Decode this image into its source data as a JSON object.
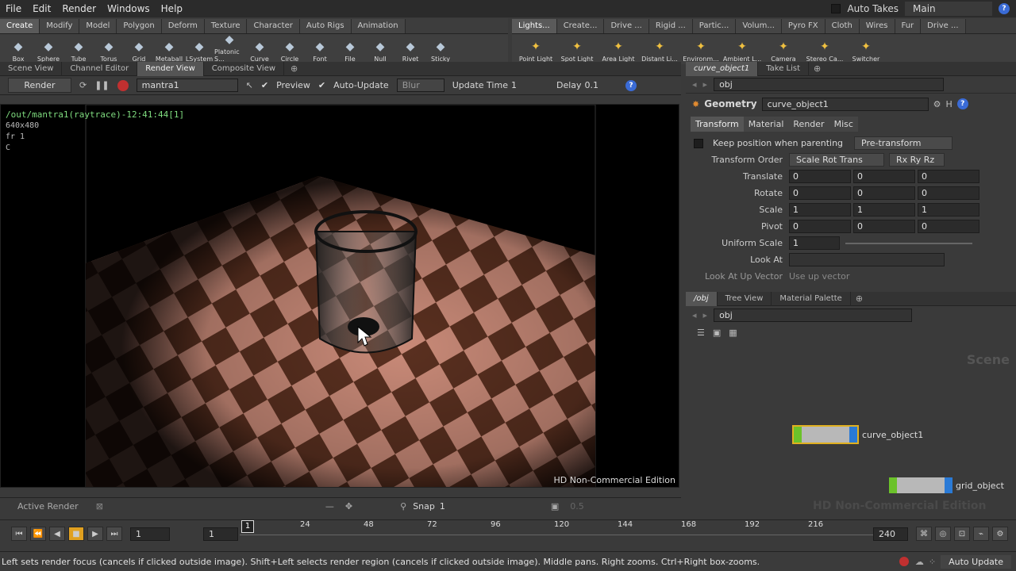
{
  "menubar": {
    "items": [
      "File",
      "Edit",
      "Render",
      "Windows",
      "Help"
    ],
    "auto_takes": "Auto Takes",
    "desktop": "Main"
  },
  "shelf_left": {
    "tabs": [
      "Create",
      "Modify",
      "Model",
      "Polygon",
      "Deform",
      "Texture",
      "Character",
      "Auto Rigs",
      "Animation"
    ],
    "tools": [
      {
        "label": "Box",
        "icon": "box-icon"
      },
      {
        "label": "Sphere",
        "icon": "sphere-icon"
      },
      {
        "label": "Tube",
        "icon": "tube-icon"
      },
      {
        "label": "Torus",
        "icon": "torus-icon"
      },
      {
        "label": "Grid",
        "icon": "grid-icon"
      },
      {
        "label": "Metaball",
        "icon": "metaball-icon"
      },
      {
        "label": "LSystem",
        "icon": "lsystem-icon"
      },
      {
        "label": "Platonic S...",
        "icon": "platonic-icon"
      },
      {
        "label": "Curve",
        "icon": "curve-icon"
      },
      {
        "label": "Circle",
        "icon": "circle-icon"
      },
      {
        "label": "Font",
        "icon": "font-icon"
      },
      {
        "label": "File",
        "icon": "file-icon"
      },
      {
        "label": "Null",
        "icon": "null-icon"
      },
      {
        "label": "Rivet",
        "icon": "rivet-icon"
      },
      {
        "label": "Sticky",
        "icon": "sticky-icon"
      }
    ]
  },
  "shelf_right": {
    "tabs": [
      "Lights...",
      "Create...",
      "Drive ...",
      "Rigid ...",
      "Partic...",
      "Volum...",
      "Pyro FX",
      "Cloth",
      "Wires",
      "Fur",
      "Drive ..."
    ],
    "tools": [
      {
        "label": "Point Light",
        "icon": "point-light-icon"
      },
      {
        "label": "Spot Light",
        "icon": "spot-light-icon"
      },
      {
        "label": "Area Light",
        "icon": "area-light-icon"
      },
      {
        "label": "Distant Li...",
        "icon": "distant-light-icon"
      },
      {
        "label": "Environm...",
        "icon": "environment-light-icon"
      },
      {
        "label": "Ambient L...",
        "icon": "ambient-light-icon"
      },
      {
        "label": "Camera",
        "icon": "camera-icon"
      },
      {
        "label": "Stereo Ca...",
        "icon": "stereo-camera-icon"
      },
      {
        "label": "Switcher",
        "icon": "switcher-icon"
      }
    ]
  },
  "left_pane": {
    "tabs": [
      "Scene View",
      "Channel Editor",
      "Render View",
      "Composite View"
    ],
    "render_button": "Render",
    "renderer": "mantra1",
    "preview": "Preview",
    "auto_update": "Auto-Update",
    "blur": "Blur",
    "update_time_label": "Update Time",
    "update_time_value": "1",
    "delay_label": "Delay",
    "delay_value": "0.1",
    "overlay_path": "/out/mantra1(raytrace)-12:41:44[1]",
    "overlay_res": "640x480",
    "overlay_frame": "fr 1",
    "overlay_c": "C",
    "watermark": "HD Non-Commercial Edition",
    "bottom_label": "Active Render",
    "snap_label": "Snap",
    "snap_value": "1",
    "dim_value": "0.5"
  },
  "param_pane": {
    "tabs": [
      "curve_object1",
      "Take List"
    ],
    "path": "obj",
    "type_label": "Geometry",
    "node_name": "curve_object1",
    "sub_tabs": [
      "Transform",
      "Material",
      "Render",
      "Misc"
    ],
    "keep_position": "Keep position when parenting",
    "pre_transform": "Pre-transform",
    "transform_order_label": "Transform Order",
    "transform_order_value": "Scale Rot Trans",
    "rot_order_value": "Rx Ry Rz",
    "rows": [
      {
        "label": "Translate",
        "v": [
          "0",
          "0",
          "0"
        ]
      },
      {
        "label": "Rotate",
        "v": [
          "0",
          "0",
          "0"
        ]
      },
      {
        "label": "Scale",
        "v": [
          "1",
          "1",
          "1"
        ]
      },
      {
        "label": "Pivot",
        "v": [
          "0",
          "0",
          "0"
        ]
      }
    ],
    "uniform_scale_label": "Uniform Scale",
    "uniform_scale_value": "1",
    "look_at_label": "Look At",
    "look_up_label": "Look At Up Vector",
    "look_up_value": "Use up vector"
  },
  "network_pane": {
    "tabs": [
      "/obj",
      "Tree View",
      "Material Palette"
    ],
    "path": "obj",
    "scene_watermark": "Scene",
    "hd_watermark": "HD Non-Commercial Edition",
    "nodes": [
      {
        "name": "curve_object1"
      },
      {
        "name": "grid_object"
      }
    ]
  },
  "timeline": {
    "frame_field": "1",
    "start_field": "1",
    "ticks": [
      "24",
      "48",
      "72",
      "96",
      "120",
      "144",
      "168",
      "192",
      "216"
    ],
    "current": "1",
    "end": "240"
  },
  "status": {
    "message": "Left sets render focus (cancels if clicked outside image). Shift+Left selects render region (cancels if clicked outside image). Middle pans. Right zooms. Ctrl+Right box-zooms.",
    "auto_update": "Auto Update"
  }
}
